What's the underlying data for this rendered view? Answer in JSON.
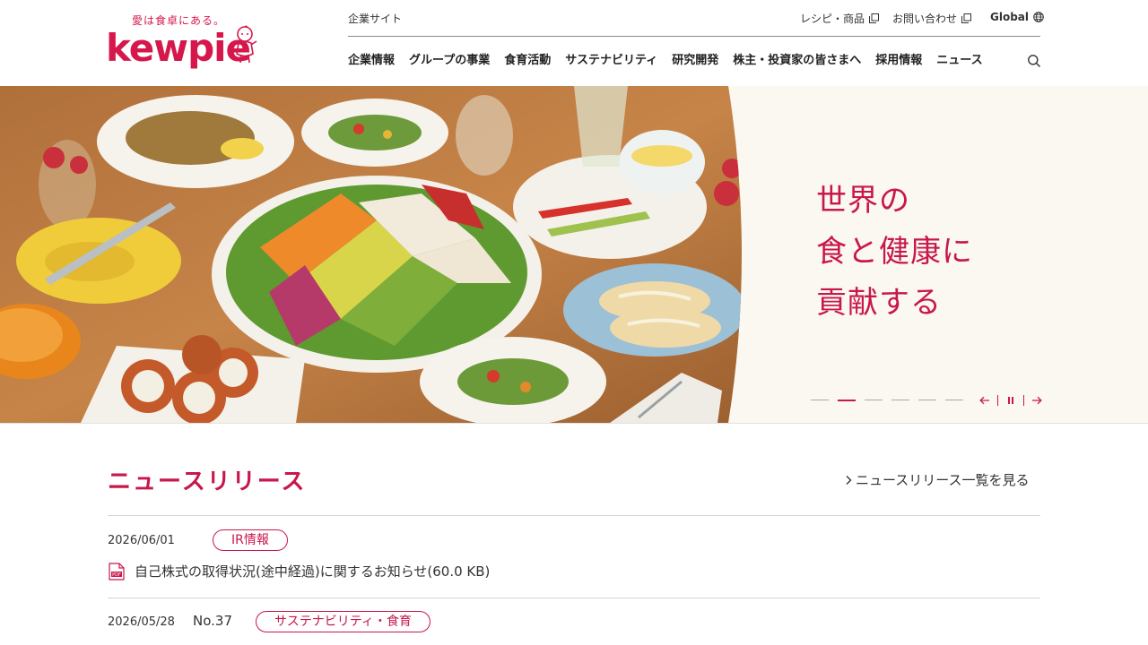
{
  "header": {
    "logo": {
      "tagline": "愛は食卓にある。",
      "wordmark": "kewpie",
      "mascot_icon": "kewpie-doll-icon"
    },
    "corporate_site_label": "企業サイト",
    "utility_links": [
      {
        "label": "レシピ・商品",
        "icon": "external-window-icon"
      },
      {
        "label": "お問い合わせ",
        "icon": "external-window-icon"
      },
      {
        "label": "Global",
        "icon": "globe-icon"
      }
    ],
    "nav": [
      {
        "label": "企業情報"
      },
      {
        "label": "グループの事業"
      },
      {
        "label": "食育活動"
      },
      {
        "label": "サステナビリティ"
      },
      {
        "label": "研究開発"
      },
      {
        "label": "株主・投資家の皆さまへ"
      },
      {
        "label": "採用情報"
      },
      {
        "label": "ニュース"
      }
    ],
    "search_icon": "search-icon"
  },
  "hero": {
    "copy_lines": [
      "世界の",
      "食と健康に",
      "貢献する"
    ],
    "slides_total": 6,
    "active_slide_index": 1,
    "controls": {
      "prev_icon": "arrow-left-icon",
      "pause_icon": "pause-icon",
      "next_icon": "arrow-right-icon"
    }
  },
  "news": {
    "title": "ニュースリリース",
    "more_link": "ニュースリリース一覧を見る",
    "items": [
      {
        "date": "2026/06/01",
        "number": "",
        "tag": "IR情報",
        "title": "自己株式の取得状況(途中経過)に関するお知らせ(60.0 KB)",
        "icon": "pdf-icon"
      },
      {
        "date": "2026/05/28",
        "number": "No.37",
        "tag": "サステナビリティ・食育",
        "title": "",
        "icon": ""
      }
    ]
  },
  "colors": {
    "brand": "#c8174a",
    "hero_background": "#fbf8f1",
    "text": "#333333"
  }
}
